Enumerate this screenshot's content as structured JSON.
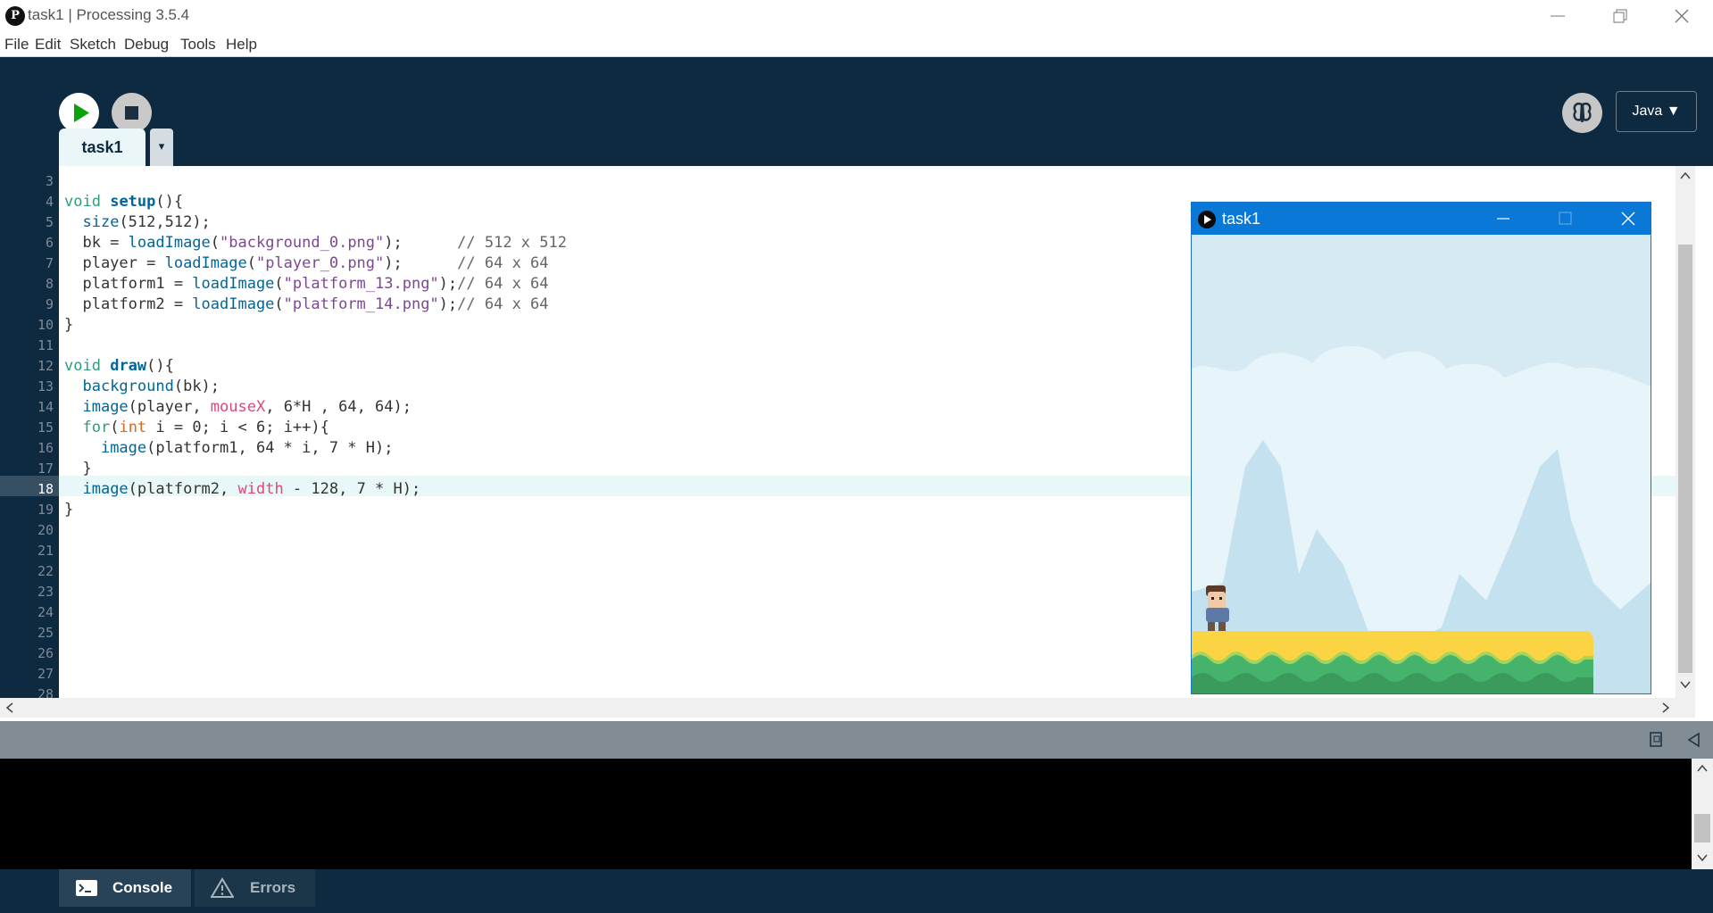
{
  "window": {
    "title": "task1 | Processing 3.5.4"
  },
  "menu": [
    "File",
    "Edit",
    "Sketch",
    "Debug",
    "Tools",
    "Help"
  ],
  "toolbar": {
    "mode": "Java ▼"
  },
  "tab": {
    "name": "task1",
    "menu_glyph": "▾"
  },
  "editor": {
    "line_numbers": [
      "3",
      "4",
      "5",
      "6",
      "7",
      "8",
      "9",
      "10",
      "11",
      "12",
      "13",
      "14",
      "15",
      "16",
      "17",
      "18",
      "19",
      "20",
      "21",
      "22",
      "23",
      "24",
      "25",
      "26",
      "27",
      "28"
    ],
    "current_line": "18",
    "code_text": [
      "",
      "void setup(){",
      "  size(512,512);",
      "  bk = loadImage(\"background_0.png\");      // 512 x 512",
      "  player = loadImage(\"player_0.png\");      // 64 x 64",
      "  platform1 = loadImage(\"platform_13.png\");// 64 x 64",
      "  platform2 = loadImage(\"platform_14.png\");// 64 x 64",
      "}",
      "",
      "void draw(){",
      "  background(bk);",
      "  image(player, mouseX, 6*H , 64, 64);",
      "  for(int i = 0; i < 6; i++){",
      "    image(platform1, 64 * i, 7 * H);",
      "  }",
      "  image(platform2, width - 128, 7 * H);",
      "}"
    ]
  },
  "console": {
    "tab_label": "Console",
    "errors_label": "Errors"
  },
  "sketch_window": {
    "title": "task1"
  },
  "colors": {
    "ide_dark": "#0e2a40",
    "editor_bg": "#ffffff",
    "sketch_sky": "#d5eaf3",
    "grass": "#3eaa64",
    "sand": "#fbd444"
  }
}
